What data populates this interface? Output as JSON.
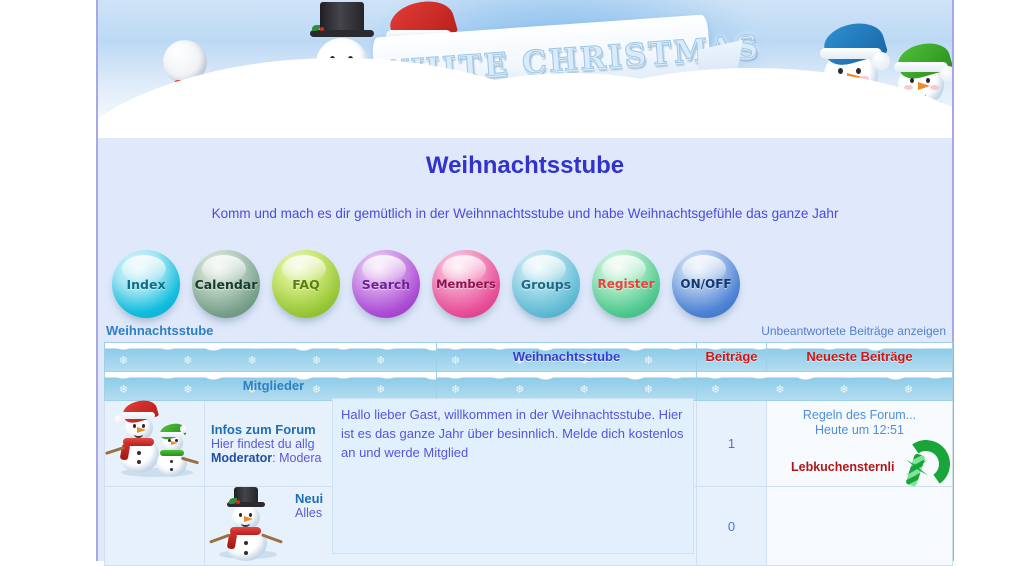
{
  "banner": {
    "ribbon_text": "WHITE CHRISTMAS",
    "alt": "white-christmas-snowmen-banner"
  },
  "site": {
    "title": "Weihnachtsstube",
    "subtitle": "Komm und mach es dir gemütlich in der Weihnnachtsstube und habe Weihnachtsgefühle das ganze Jahr"
  },
  "nav": {
    "buttons": [
      {
        "label": "Index",
        "key": "index"
      },
      {
        "label": "Calendar",
        "key": "calendar"
      },
      {
        "label": "FAQ",
        "key": "faq"
      },
      {
        "label": "Search",
        "key": "search"
      },
      {
        "label": "Members",
        "key": "members"
      },
      {
        "label": "Groups",
        "key": "groups"
      },
      {
        "label": "Register",
        "key": "register"
      },
      {
        "label": "ON/OFF",
        "key": "onoff"
      }
    ]
  },
  "breadcrumb": {
    "left": "Weihnachtsstube",
    "right": "Unbeantwortete Beiträge anzeigen"
  },
  "forum_table": {
    "headers": {
      "icon": "",
      "forum": "Weihnachtsstube",
      "members": "Mitglieder",
      "posts": "Beiträge",
      "latest": "Neueste Beiträge"
    },
    "rows": [
      {
        "icon": "two-snowmen-icon",
        "name": "Infos zum Forum",
        "desc": "Hier findest du allg",
        "moderator_label": "Moderator",
        "moderator_value": "Modera",
        "posts": "1",
        "last_topic": "Regeln des Forum...",
        "last_time": "Heute um 12:51",
        "last_user": "Lebkuchensternli",
        "last_icon": "candy-cane-icon"
      },
      {
        "icon": "tophat-snowman-icon",
        "name": "Neui",
        "desc": "Alles",
        "moderator_label": "",
        "moderator_value": "",
        "posts": "0",
        "last_topic": "",
        "last_time": "",
        "last_user": "",
        "last_icon": ""
      }
    ]
  },
  "tooltip": {
    "text": "Hallo lieber Gast, willkommen in der Weihnachtsstube. Hier ist es das ganze Jahr über besinnlich. Melde dich kostenlos an und werde Mitglied"
  },
  "colors": {
    "page_bg": "#dfe9fb",
    "frame_border": "#a8a8e8",
    "title_blue": "#3333cc",
    "header_red": "#d21414",
    "link_blue": "#1f6fb5",
    "user_red": "#b01818"
  }
}
